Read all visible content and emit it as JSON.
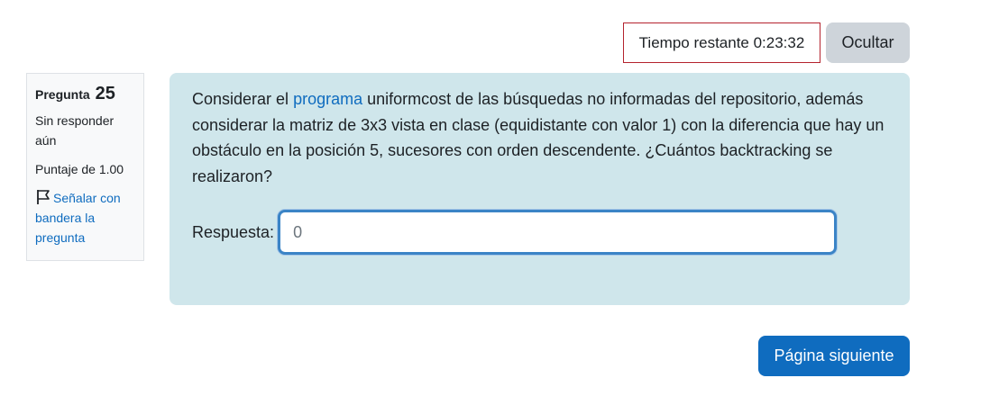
{
  "timer": {
    "text": "Tiempo restante 0:23:32",
    "hide_label": "Ocultar"
  },
  "info": {
    "question_label": "Pregunta",
    "question_number": "25",
    "state": "Sin responder aún",
    "grade": "Puntaje de 1.00",
    "flag_label": "Señalar con bandera la pregunta",
    "flag_icon": "flag-icon"
  },
  "question": {
    "text_before_link": "Considerar el ",
    "link_text": "programa",
    "text_after_link": " uniformcost de las búsquedas no informadas del repositorio, además considerar la matriz de 3x3 vista en clase (equidistante con valor 1) con la diferencia que hay un obstáculo en la posición 5, sucesores con orden descendente. ¿Cuántos backtracking se realizaron?",
    "answer_label": "Respuesta:",
    "answer_value": "0"
  },
  "navigation": {
    "next_label": "Página siguiente"
  },
  "colors": {
    "accent": "#0f6cbf",
    "content_bg": "#cfe6eb",
    "timer_border": "#b4232e",
    "hide_button_bg": "#ced4da"
  }
}
